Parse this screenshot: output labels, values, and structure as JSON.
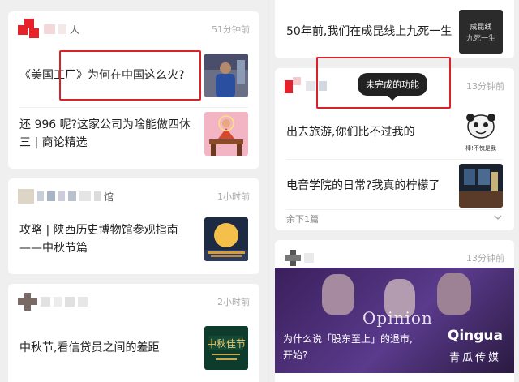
{
  "left": {
    "cards": [
      {
        "source_suffix": "人",
        "time": "51分钟前",
        "items": [
          {
            "title": "《美国工厂》为何在中国这么火?",
            "thumb": "man-photo"
          },
          {
            "title": "还 996 呢?这家公司为啥能做四休三 | 商论精选",
            "thumb": "meditation-illustration"
          }
        ]
      },
      {
        "source_suffix": "馆",
        "time": "1小时前",
        "items": [
          {
            "title": "攻略 | 陕西历史博物馆参观指南——中秋节篇",
            "thumb": "moon-night-image"
          }
        ]
      },
      {
        "source_suffix": "",
        "time": "2小时前",
        "items": [
          {
            "title": "中秋节,看信贷员之间的差距",
            "thumb": "mid-autumn-poster"
          }
        ]
      }
    ]
  },
  "right": {
    "top_item": {
      "title": "50年前,我们在成昆线上九死一生",
      "thumb": "book-cover"
    },
    "card2": {
      "time": "13分钟前",
      "tooltip": "未完成的功能",
      "items": [
        {
          "title": "出去旅游,你们比不过我的",
          "thumb": "panda-meme",
          "thumb_caption": "棒!不愧是我"
        },
        {
          "title": "电音学院的日常?我真的柠檬了",
          "thumb": "club-scene"
        }
      ],
      "more_label": "余下1篇",
      "more_icon": "chevron-down-icon"
    },
    "card3": {
      "time": "13分钟前",
      "banner_label": "Opinion",
      "caption": "为什么说「股东至上」的退市,开始?",
      "watermark_logo": "Qingua",
      "watermark_text": "青瓜传媒"
    }
  },
  "colors": {
    "highlight": "#d9232b",
    "tooltip_bg": "#222222",
    "banner_purple": "#4a2d72"
  }
}
